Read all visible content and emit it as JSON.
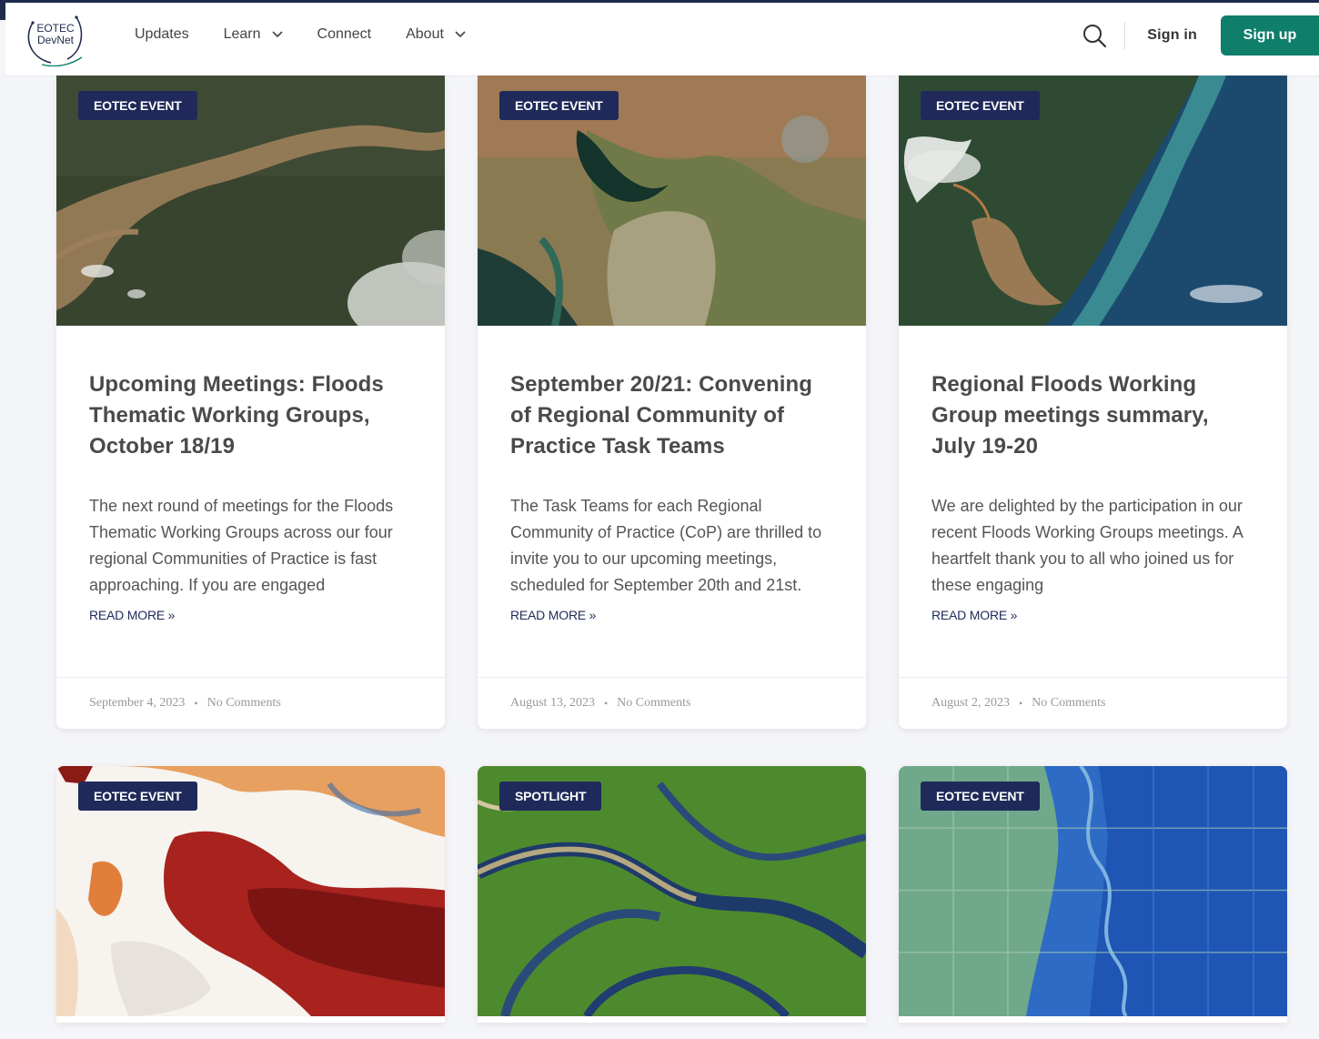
{
  "brand": {
    "line1": "EOTEC",
    "line2": "DevNet"
  },
  "nav": [
    {
      "label": "Updates",
      "has_dropdown": false
    },
    {
      "label": "Learn",
      "has_dropdown": true
    },
    {
      "label": "Connect",
      "has_dropdown": false
    },
    {
      "label": "About",
      "has_dropdown": true
    }
  ],
  "header": {
    "signin_label": "Sign in",
    "signup_label": "Sign up"
  },
  "colors": {
    "accent": "#0f7e6a",
    "badge": "#1f2a5a",
    "frame": "#1f2a4d"
  },
  "posts": [
    {
      "badge": "EOTEC EVENT",
      "title": "Upcoming Meetings: Floods Thematic Working Groups, October 18/19",
      "excerpt": "The next round of meetings for the Floods Thematic Working Groups across our four regional Communities of Practice is fast approaching. If you are engaged",
      "read_more": "READ MORE »",
      "date": "September 4, 2023",
      "comments": "No Comments",
      "image": "satellite-flood-river"
    },
    {
      "badge": "EOTEC EVENT",
      "title": "September 20/21: Convening of Regional Community of Practice Task Teams",
      "excerpt": "The Task Teams for each Regional Community of Practice (CoP) are thrilled to invite you to our upcoming meetings, scheduled for September 20th and 21st.",
      "read_more": "READ MORE »",
      "date": "August 13, 2023",
      "comments": "No Comments",
      "image": "satellite-delta-farmland"
    },
    {
      "badge": "EOTEC EVENT",
      "title": "Regional Floods Working Group meetings summary, July 19-20",
      "excerpt": "We are delighted by the participation in our recent Floods Working Groups meetings. A heartfelt thank you to all who joined us for these engaging",
      "read_more": "READ MORE »",
      "date": "August 2, 2023",
      "comments": "No Comments",
      "image": "satellite-coast-sediment"
    },
    {
      "badge": "EOTEC EVENT",
      "image": "europe-temperature-map"
    },
    {
      "badge": "SPOTLIGHT",
      "image": "false-color-river-network"
    },
    {
      "badge": "EOTEC EVENT",
      "image": "flooded-fields-river"
    }
  ]
}
